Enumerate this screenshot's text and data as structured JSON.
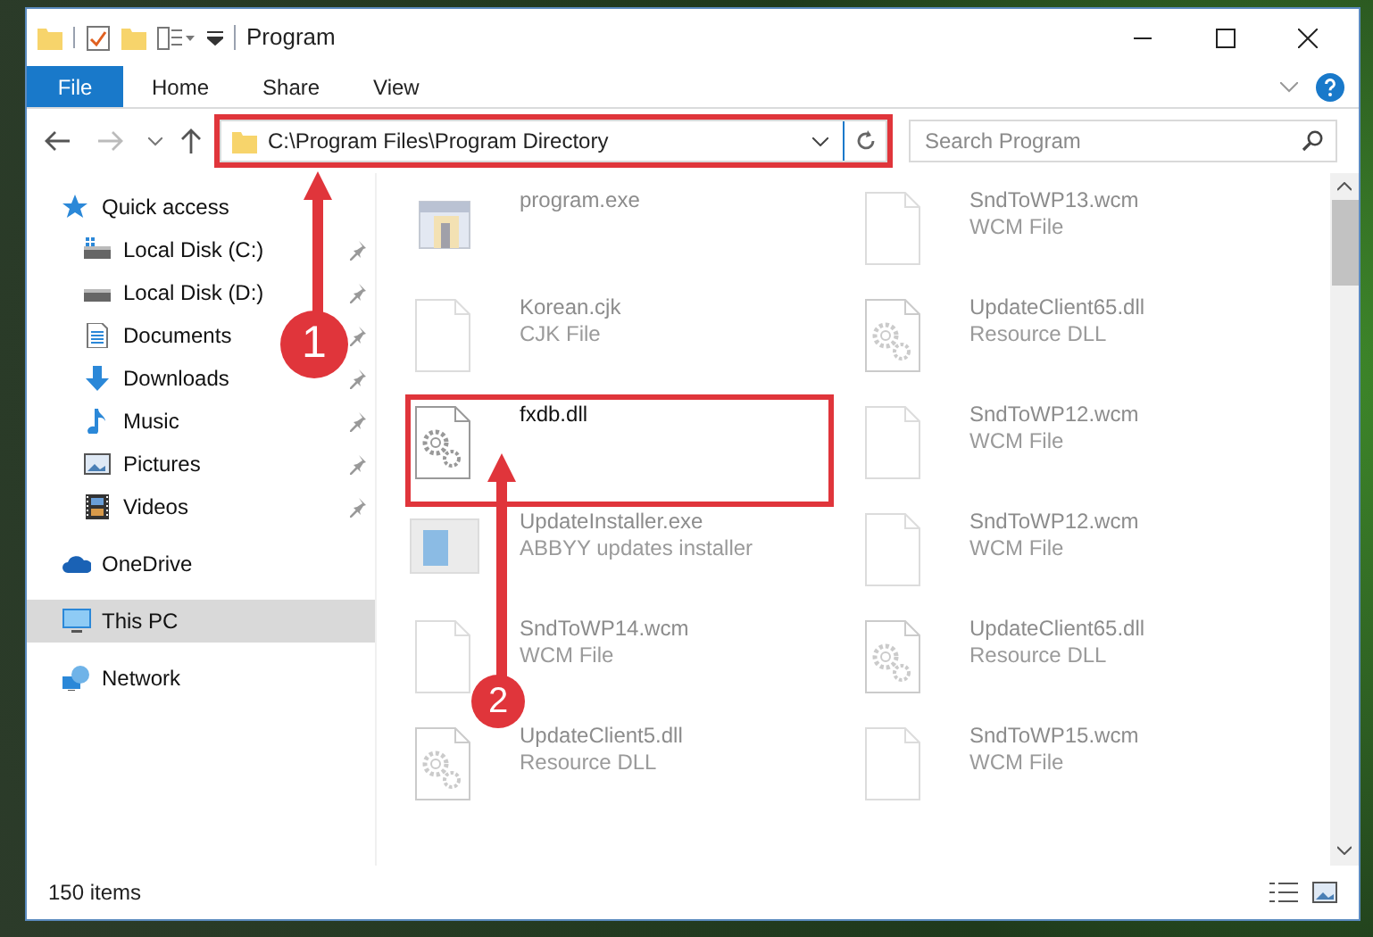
{
  "window": {
    "title": "Program"
  },
  "ribbon_tabs": [
    {
      "label": "File",
      "kind": "file"
    },
    {
      "label": "Home",
      "kind": "tab"
    },
    {
      "label": "Share",
      "kind": "tab"
    },
    {
      "label": "View",
      "kind": "tab"
    }
  ],
  "address_bar": {
    "path": "C:\\Program Files\\Program Directory",
    "highlighted": true
  },
  "search": {
    "placeholder": "Search Program"
  },
  "navigation": [
    {
      "label": "Quick access",
      "kind": "star",
      "selected": false,
      "children": [
        {
          "label": "Local Disk (C:)",
          "kind": "system-drive",
          "pinned": true
        },
        {
          "label": "Local Disk (D:)",
          "kind": "drive",
          "pinned": true
        },
        {
          "label": "Documents",
          "kind": "documents",
          "pinned": true
        },
        {
          "label": "Downloads",
          "kind": "downloads",
          "pinned": true
        },
        {
          "label": "Music",
          "kind": "music",
          "pinned": true
        },
        {
          "label": "Pictures",
          "kind": "pictures",
          "pinned": true
        },
        {
          "label": "Videos",
          "kind": "videos",
          "pinned": true
        }
      ]
    },
    {
      "label": "OneDrive",
      "kind": "cloud",
      "selected": false
    },
    {
      "label": "This PC",
      "kind": "pc",
      "selected": true
    },
    {
      "label": "Network",
      "kind": "network",
      "selected": false
    }
  ],
  "files": [
    {
      "name": "program.exe",
      "kind": "app",
      "faded": true,
      "highlighted": false
    },
    {
      "name": "SndToWP13.wcm",
      "type": "WCM File",
      "kind": "blank",
      "faded": true,
      "highlighted": false
    },
    {
      "name": "Korean.cjk",
      "type": "CJK File",
      "kind": "blank",
      "faded": true,
      "highlighted": false
    },
    {
      "name": "UpdateClient65.dll",
      "type": "Resource DLL",
      "kind": "gear",
      "faded": true,
      "highlighted": false
    },
    {
      "name": "fxdb.dll",
      "kind": "gear",
      "faded": false,
      "highlighted": true
    },
    {
      "name": "SndToWP12.wcm",
      "type": "WCM File",
      "kind": "blank",
      "faded": true,
      "highlighted": false
    },
    {
      "name": "UpdateInstaller.exe",
      "type": "ABBYY updates installer",
      "kind": "installer",
      "faded": true,
      "highlighted": false
    },
    {
      "name": "SndToWP12.wcm",
      "type": "WCM File",
      "kind": "blank",
      "faded": true,
      "highlighted": false
    },
    {
      "name": "SndToWP14.wcm",
      "type": "WCM File",
      "kind": "blank",
      "faded": true,
      "highlighted": false
    },
    {
      "name": "UpdateClient65.dll",
      "type": "Resource DLL",
      "kind": "gear",
      "faded": true,
      "highlighted": false
    },
    {
      "name": "UpdateClient5.dll",
      "type": "Resource DLL",
      "kind": "gear",
      "faded": true,
      "highlighted": false
    },
    {
      "name": "SndToWP15.wcm",
      "type": "WCM File",
      "kind": "blank",
      "faded": true,
      "highlighted": false
    }
  ],
  "status_bar": {
    "item_count": "150 items"
  },
  "annotations": [
    {
      "number": "1"
    },
    {
      "number": "2"
    }
  ]
}
